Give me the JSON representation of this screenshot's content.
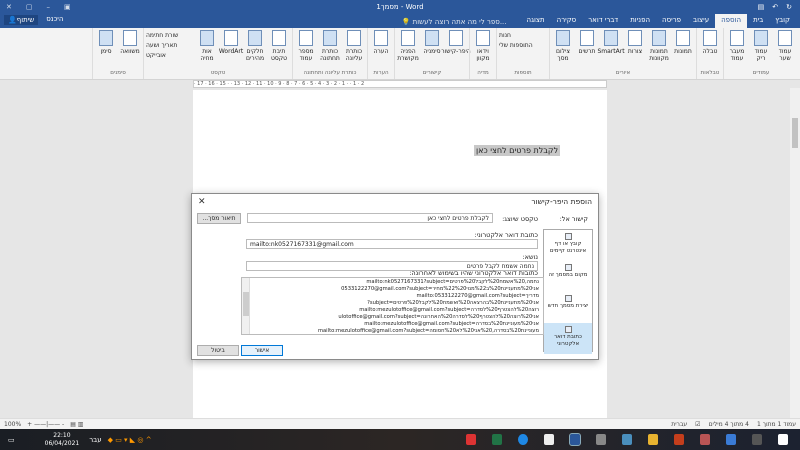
{
  "titlebar": {
    "title": "מסמך1 - Word"
  },
  "tabs": [
    {
      "label": "קובץ"
    },
    {
      "label": "בית"
    },
    {
      "label": "הוספה"
    },
    {
      "label": "עיצוב"
    },
    {
      "label": "פריסה"
    },
    {
      "label": "הפניות"
    },
    {
      "label": "דברי דואר"
    },
    {
      "label": "סקירה"
    },
    {
      "label": "תצוגה"
    }
  ],
  "search": "ספר לי מה אתה רוצה לעשות...",
  "account": {
    "signin": "היכנס",
    "share": "שיתוף"
  },
  "ribbon": [
    {
      "label": "עמודים",
      "items": [
        "עמוד שער",
        "עמוד ריק",
        "מעבר עמוד"
      ]
    },
    {
      "label": "טבלאות",
      "items": [
        "טבלה"
      ]
    },
    {
      "label": "איורים",
      "items": [
        "תמונות",
        "תמונות מקוונות",
        "צורות",
        "SmartArt",
        "תרשים",
        "צילום מסך"
      ]
    },
    {
      "label": "תוספות",
      "small": [
        "חנות",
        "התוספות שלי"
      ]
    },
    {
      "label": "מדיה",
      "items": [
        "וידאו מקוון"
      ]
    },
    {
      "label": "קישורים",
      "items": [
        "היפר-קישור",
        "סימניה",
        "הפניה מקושרת"
      ]
    },
    {
      "label": "הערות",
      "items": [
        "הערה"
      ]
    },
    {
      "label": "כותרת עליונה ותחתונה",
      "items": [
        "כותרת עליונה",
        "כותרת תחתונה",
        "מספר עמוד"
      ]
    },
    {
      "label": "טקסט",
      "items": [
        "תיבת טקסט",
        "חלקים מהירים",
        "WordArt",
        "אות מחיה"
      ],
      "small": [
        "שורת חתימה",
        "תאריך ושעה",
        "אובייקט"
      ]
    },
    {
      "label": "סימנים",
      "items": [
        "משוואה",
        "סימן"
      ]
    }
  ],
  "ruler": "· 17 · 16 · 15 · · 13 · 12 · 11 · 10 · 9 · 8 · 7 · 6 · 5 · 4 · 3 · 2 · 1 · · 1 · 2",
  "document": {
    "text": "לקבלת פרטים לחצי כאן"
  },
  "dialog": {
    "title": "הוספת היפר-קישור",
    "link_to_label": "קישור אל:",
    "link_options": [
      "קובץ או דף אינטרנט קיימים",
      "מקום במסמך זה",
      "יצירת מסמך חדש",
      "כתובת דואר אלקטרוני"
    ],
    "display_text_label": "טקסט שיוצג:",
    "display_text": "לקבלת פרטים לחצי כאן",
    "screentip_button": "תיאור מסך...",
    "email_label": "כתובת דואר אלקטרוני:",
    "email": "mailto:nk0527167331@gmail.com",
    "subject_label": "נושא:",
    "subject": "נחמה אשמח לקבל פרטים",
    "recent_label": "כתובות דואר אלקטרוני שהיו בשימוש לאחרונה:",
    "recent": [
      "mailto:nk0527167331?subject=נחמה,%20אשמח%20לקבל%20פרטים",
      "0533122270@gmail.com?subject=אני%20מתעניינת%20ב%22מנוי%22%20מחיר",
      "mailto:0533122270@gmail.com?subject=מדריך",
      "?subject=אני%20מתעניינת%20בהרצאה%20ואשמח%20לקבל%20פרטים",
      "mailto:mezulotoffice@gmail.com?subject=רוצה%20להצטרף%20לסדרה",
      "ulotoffice@gmail.com?subject=אני%20רוצה%20להצטרף%20לסדרה%20האחרונה",
      "mailto:mezulotoffice@gmail.com?subject=אני%20מעוניינת%20בסדרה",
      "mailto:mezulotoffice@gmail.com?subject=מעוניינת%20בסדרה,%20אני%20לא%20חסומה"
    ],
    "ok": "אישור",
    "cancel": "ביטול"
  },
  "status": {
    "page": "עמוד 1 מתוך 1",
    "words": "4 מתוך 4 מילים",
    "language": "עברית",
    "zoom": "100%"
  },
  "taskbar": {
    "time": "22:10",
    "date": "06/04/2021",
    "lang": "עבר"
  }
}
